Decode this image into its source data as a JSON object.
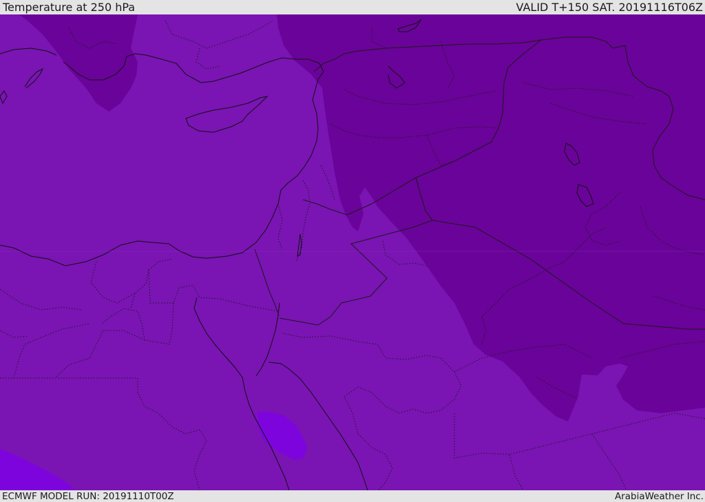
{
  "header": {
    "title": "Temperature at 250 hPa",
    "valid": "VALID T+150 SAT. 20191116T06Z"
  },
  "footer": {
    "model_run": "ECMWF MODEL RUN: 20191110T00Z",
    "credit": "ArabiaWeather Inc."
  },
  "map": {
    "variable": "temperature",
    "level": "250 hPa",
    "fill_colors": {
      "base": "#7a14b3",
      "cold_zone": "#6a0399",
      "warm_patch": "#7e04de"
    },
    "line_colors": {
      "coastline": "#111111",
      "border": "#1a1a1a"
    }
  }
}
